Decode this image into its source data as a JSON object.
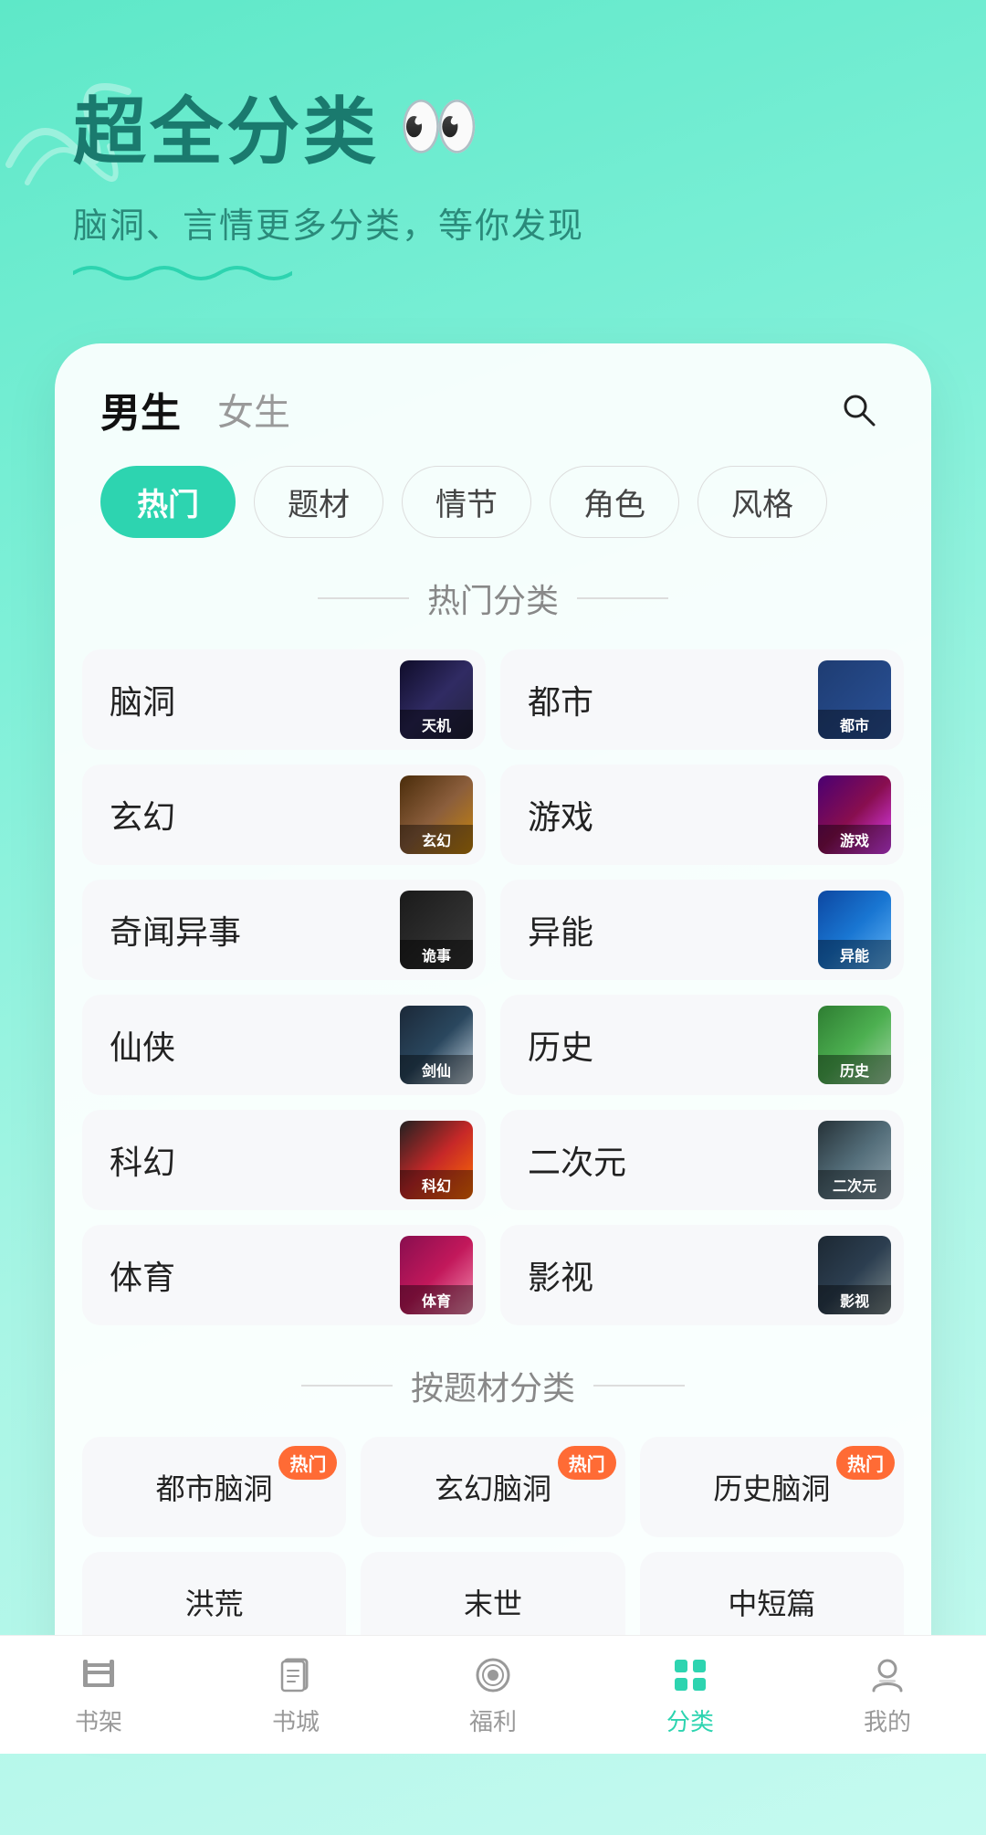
{
  "header": {
    "title": "超全分类",
    "subtitle": "脑洞、言情更多分类，等你发现",
    "eyes": "👀"
  },
  "genderTabs": {
    "active": "男生",
    "inactive": "女生"
  },
  "filterPills": [
    {
      "label": "热门",
      "active": true
    },
    {
      "label": "题材",
      "active": false
    },
    {
      "label": "情节",
      "active": false
    },
    {
      "label": "角色",
      "active": false
    },
    {
      "label": "风格",
      "active": false
    }
  ],
  "hotSection": {
    "title": "热门分类",
    "items": [
      {
        "label": "脑洞",
        "coverClass": "cover-brain"
      },
      {
        "label": "都市",
        "coverClass": "cover-city"
      },
      {
        "label": "玄幻",
        "coverClass": "cover-fantasy"
      },
      {
        "label": "游戏",
        "coverClass": "cover-game"
      },
      {
        "label": "奇闻异事",
        "coverClass": "cover-mystery"
      },
      {
        "label": "异能",
        "coverClass": "cover-psychic"
      },
      {
        "label": "仙侠",
        "coverClass": "cover-xianxia"
      },
      {
        "label": "历史",
        "coverClass": "cover-history"
      },
      {
        "label": "科幻",
        "coverClass": "cover-scifi"
      },
      {
        "label": "二次元",
        "coverClass": "cover-anime"
      },
      {
        "label": "体育",
        "coverClass": "cover-sports"
      },
      {
        "label": "影视",
        "coverClass": "cover-media"
      }
    ]
  },
  "topicSection": {
    "title": "按题材分类",
    "items": [
      {
        "label": "都市脑洞",
        "hot": true
      },
      {
        "label": "玄幻脑洞",
        "hot": true
      },
      {
        "label": "历史脑洞",
        "hot": true
      },
      {
        "label": "洪荒",
        "hot": false
      },
      {
        "label": "末世",
        "hot": false
      },
      {
        "label": "中短篇",
        "hot": false
      }
    ]
  },
  "bottomNav": {
    "items": [
      {
        "label": "书架",
        "active": false,
        "icon": "bookshelf"
      },
      {
        "label": "书城",
        "active": false,
        "icon": "bookstore"
      },
      {
        "label": "福利",
        "active": false,
        "icon": "welfare"
      },
      {
        "label": "分类",
        "active": true,
        "icon": "category"
      },
      {
        "label": "我的",
        "active": false,
        "icon": "profile"
      }
    ]
  },
  "hotBadgeText": "热门"
}
